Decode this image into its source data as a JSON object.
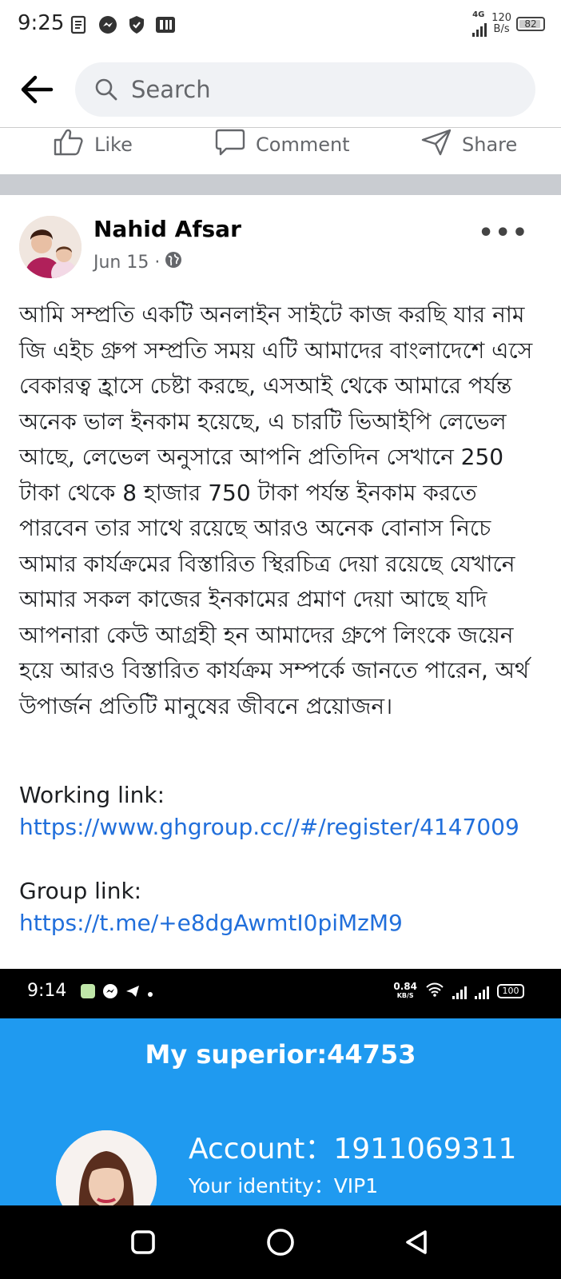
{
  "status_bar": {
    "time": "9:25",
    "network": "4G",
    "speed_value": "120",
    "speed_unit": "B/s",
    "battery": "82",
    "notification_icons": [
      "document-icon",
      "messenger-icon",
      "shield-icon",
      "app-icon"
    ]
  },
  "search": {
    "placeholder": "Search"
  },
  "actions": {
    "like": "Like",
    "comment": "Comment",
    "share": "Share"
  },
  "post": {
    "author": "Nahid Afsar",
    "date": "Jun 15 ·",
    "body": "আমি সম্প্রতি একটি অনলাইন সাইটে কাজ করছি যার নাম জি এইচ গ্রুপ সম্প্রতি সময় এটি আমাদের বাংলাদেশে এসে বেকারত্ব হ্রাসে চেষ্টা করছে, এসআই থেকে আমারে পর্যন্ত অনেক ভাল ইনকাম হয়েছে, এ চারটি ভিআইপি লেভেল আছে, লেভেল অনুসারে আপনি প্রতিদিন সেখানে 250 টাকা থেকে 8 হাজার 750 টাকা পর্যন্ত ইনকাম করতে পারবেন তার সাথে রয়েছে আরও অনেক বোনাস নিচে আমার কার্যক্রমের বিস্তারিত স্থিরচিত্র দেয়া রয়েছে যেখানে আমার সকল কাজের ইনকামের প্রমাণ দেয়া আছে যদি আপনারা কেউ আগ্রহী হন আমাদের গ্রুপে লিংকে জয়েন হয়ে আরও বিস্তারিত কার্যক্রম সম্পর্কে জানতে পারেন, অর্থ উপার্জন প্রতিটি মানুষের জীবনে প্রয়োজন।",
    "working_label": "Working link:",
    "working_url": "https://www.ghgroup.cc//#/register/4147009",
    "group_label": "Group link:",
    "group_url": "https://t.me/+e8dgAwmtI0piMzM9"
  },
  "embedded_screenshot": {
    "time": "9:14",
    "speed_value": "0.84",
    "speed_unit": "KB/S",
    "battery": "100",
    "superior": "My superior:44753",
    "account": "Account：1911069311",
    "identity": "Your identity：VIP1",
    "background_color": "#1f9af0"
  }
}
